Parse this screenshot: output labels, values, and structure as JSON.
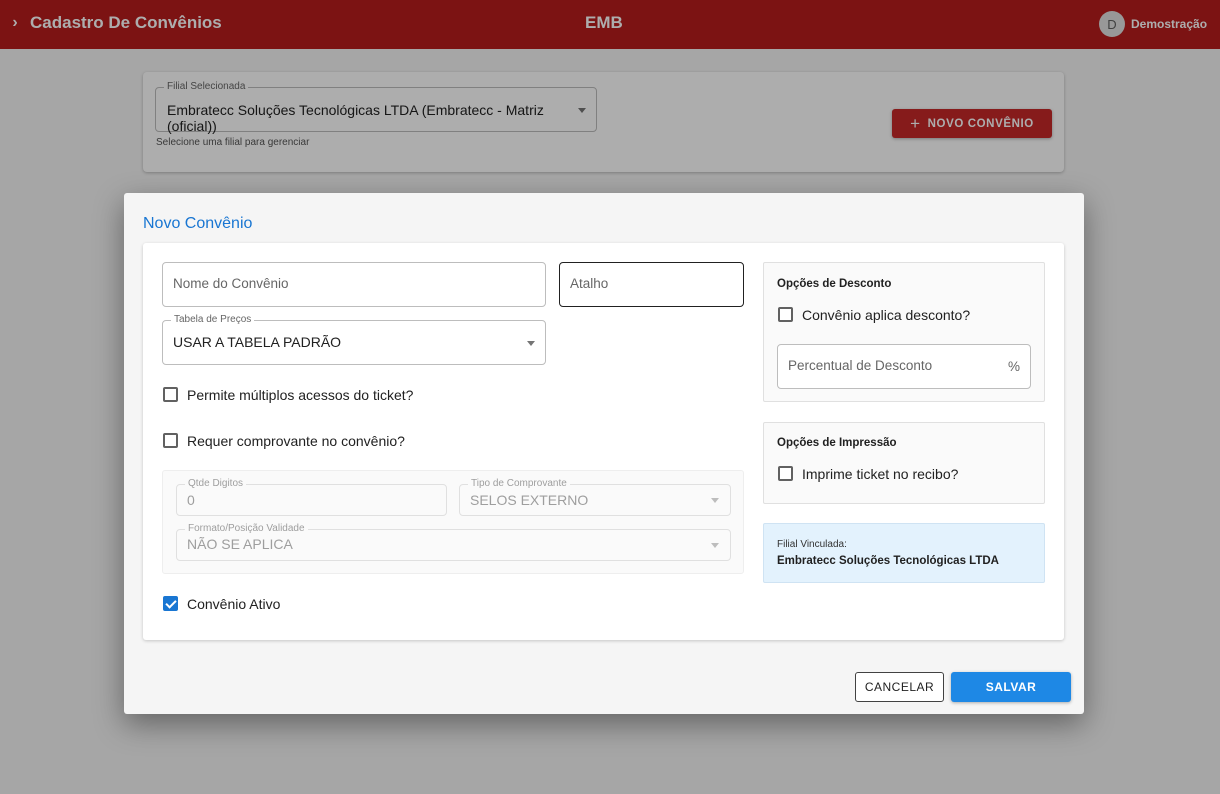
{
  "header": {
    "title": "Cadastro De Convênios",
    "center_label": "EMB",
    "avatar_initial": "D",
    "user_name": "Demostração"
  },
  "filial": {
    "label": "Filial Selecionada",
    "value": "Embratecc Soluções Tecnológicas LTDA (Embratecc - Matriz (oficial))",
    "helper": "Selecione uma filial para gerenciar"
  },
  "new_button": {
    "icon": "plus-icon",
    "label": "NOVO CONVÊNIO"
  },
  "dialog": {
    "title": "Novo Convênio",
    "nome_placeholder": "Nome do Convênio",
    "atalho_placeholder": "Atalho",
    "tabela": {
      "label": "Tabela de Preços",
      "value": "USAR A TABELA PADRÃO"
    },
    "multi_access": {
      "label": "Permite múltiplos acessos do ticket?",
      "checked": false
    },
    "requer_comprovante": {
      "label": "Requer comprovante no convênio?",
      "checked": false
    },
    "qtde_digitos": {
      "label": "Qtde Digitos",
      "value": "0"
    },
    "tipo_comprovante": {
      "label": "Tipo de Comprovante",
      "value": "SELOS EXTERNO"
    },
    "formato_validade": {
      "label": "Formato/Posição Validade",
      "value": "NÃO SE APLICA"
    },
    "ativo": {
      "label": "Convênio Ativo",
      "checked": true
    },
    "desconto": {
      "title": "Opções de Desconto",
      "checkbox_label": "Convênio aplica desconto?",
      "percent_placeholder": "Percentual de Desconto",
      "percent_suffix": "%"
    },
    "impressao": {
      "title": "Opções de Impressão",
      "checkbox_label": "Imprime ticket no recibo?"
    },
    "vinculada": {
      "label": "Filial Vinculada:",
      "value": "Embratecc Soluções Tecnológicas LTDA"
    },
    "cancel_label": "CANCELAR",
    "save_label": "SALVAR"
  },
  "colors": {
    "appbar": "#b71c1c",
    "primary": "#1976d2",
    "danger": "#c62828",
    "info_bg": "#e3f2fd"
  }
}
